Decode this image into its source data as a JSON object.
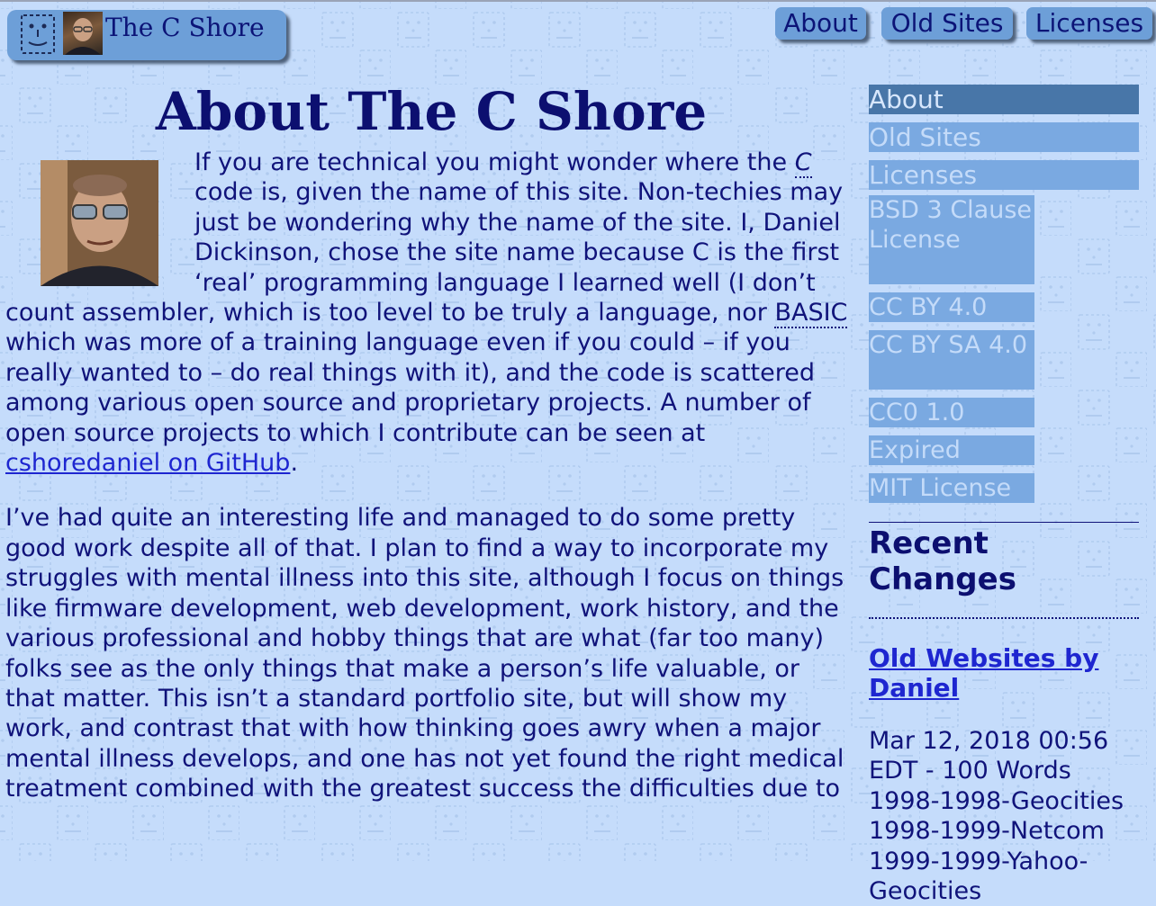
{
  "header": {
    "site_title": "The C Shore"
  },
  "top_nav": [
    {
      "label": "About"
    },
    {
      "label": "Old Sites"
    },
    {
      "label": "Licenses"
    }
  ],
  "main": {
    "page_title": "About The C Shore",
    "para1": {
      "t1": "If you are technical you might wonder where the ",
      "c_abbr": "C",
      "t2": " code is, given the name of this site. Non-techies may just be wondering why the name of the site. I, Daniel Dickinson, chose the site name because C is the first ‘real’ programming language I learned well (I don’t count assembler, which is too level to be truly a language, nor ",
      "basic_abbr": "BASIC",
      "t3": " which was more of a training language even if you could – if you really wanted to – do real things with it), and the code is scattered among various open source and proprietary projects. A number of open source projects to which I contribute can be seen at ",
      "github_link": "cshoredaniel on GitHub",
      "t4": "."
    },
    "para2": "I’ve had quite an interesting life and managed to do some pretty good work despite all of that. I plan to find a way to incorporate my struggles with mental illness into this site, although I focus on things like firmware development, web development, work history, and the various professional and hobby things that are what (far too many) folks see as the only things that make a person’s life valuable, or that matter. This isn’t a standard portfolio site, but will show my work, and contrast that with how thinking goes awry when a major mental illness develops, and one has not yet found the right medical treatment combined with the greatest success the difficulties due to"
  },
  "sidebar": {
    "items": [
      {
        "label": "About",
        "active": true
      },
      {
        "label": "Old Sites",
        "active": false
      },
      {
        "label": "Licenses",
        "active": false
      }
    ],
    "license_items": [
      {
        "label": "BSD 3 Clause License"
      },
      {
        "label": "CC BY 4.0"
      },
      {
        "label": "CC BY SA 4.0"
      },
      {
        "label": "CC0 1.0"
      },
      {
        "label": "Expired"
      },
      {
        "label": "MIT License"
      }
    ],
    "recent_changes_title": "Recent Changes",
    "recent_link": "Old Websites by Daniel",
    "recent_desc": "Mar 12, 2018 00:56 EDT - 100 Words 1998-1998-Geocities 1998-1999-Netcom 1999-1999-Yahoo-Geocities"
  },
  "colors": {
    "background": "#c5dcfb",
    "nav_button": "#6d9fd8",
    "text": "#10137a",
    "link": "#1e26d0",
    "sidebar_item": "#7aa9e1",
    "sidebar_active": "#4876a8"
  },
  "icons": {
    "logo": "smiley-face-icon",
    "avatar": "portrait-photo"
  }
}
